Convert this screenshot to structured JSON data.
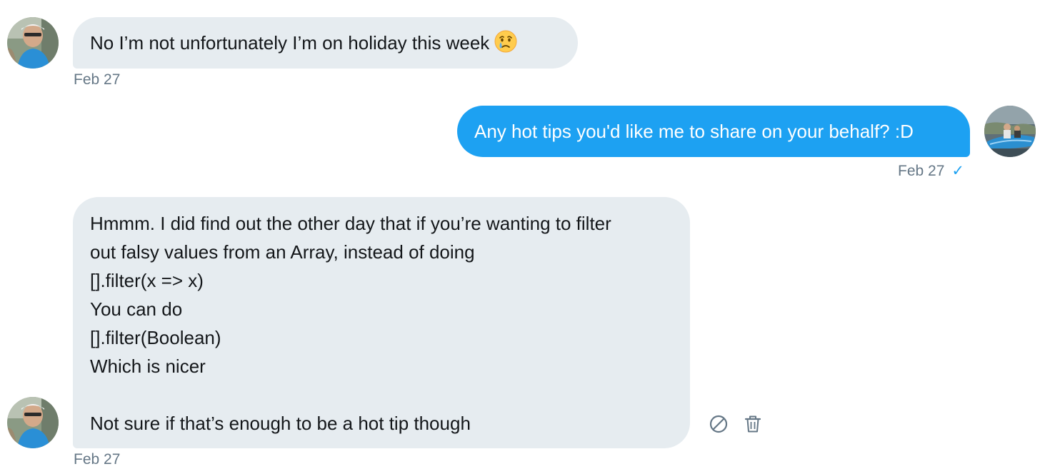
{
  "messages": [
    {
      "direction": "incoming",
      "text": "No I’m not unfortunately I’m on holiday this week",
      "emoji": "crying-face-emoji",
      "timestamp": "Feb 27"
    },
    {
      "direction": "outgoing",
      "text": "Any hot tips you'd like me to share on your behalf? :D",
      "timestamp": "Feb 27",
      "read_receipt": "✓"
    },
    {
      "direction": "incoming",
      "lines": [
        "Hmmm. I did find out the other day that if you’re wanting to filter",
        "out falsy values from an Array, instead of doing",
        "[].filter(x => x)",
        "You can do",
        "[].filter(Boolean)",
        "Which is nicer",
        "",
        "Not sure if that’s enough to be a hot tip though"
      ],
      "timestamp": "Feb 27",
      "actions": [
        "block-icon",
        "delete-trash-icon"
      ]
    }
  ],
  "colors": {
    "incoming_bubble": "#e6ecf0",
    "outgoing_bubble": "#1da1f2",
    "timestamp_text": "#657786",
    "accent": "#1da1f2"
  }
}
